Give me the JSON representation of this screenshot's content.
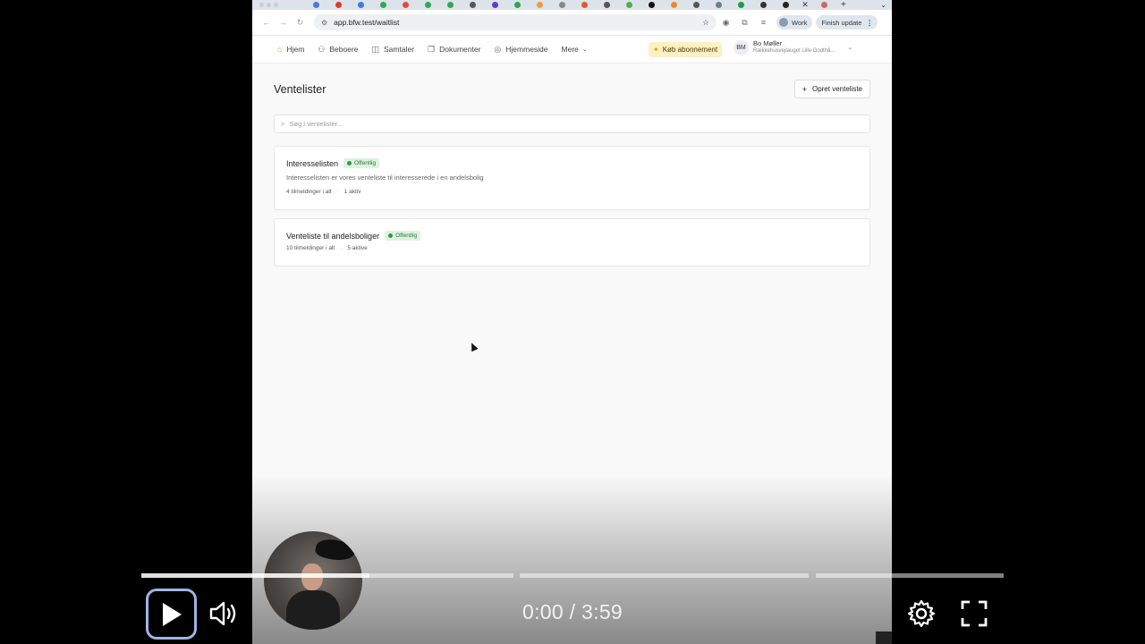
{
  "browser": {
    "url": "app.bfw.test/waitlist",
    "profile_label": "Work",
    "update_label": "Finish update",
    "new_tab": "+",
    "close_tab": "✕"
  },
  "app_nav": {
    "items": [
      {
        "label": "Hjem",
        "icon": "home-icon"
      },
      {
        "label": "Beboere",
        "icon": "users-icon"
      },
      {
        "label": "Samtaler",
        "icon": "chat-icon"
      },
      {
        "label": "Dokumenter",
        "icon": "documents-icon"
      },
      {
        "label": "Hjemmeside",
        "icon": "globe-icon"
      },
      {
        "label": "Mere",
        "icon": "chevron-down-icon"
      }
    ],
    "subscribe_label": "Køb abonnement",
    "user": {
      "initials": "BM",
      "name": "Bo Møller",
      "org": "Rækkehusvejlauget Lille Godthå..."
    }
  },
  "page": {
    "title": "Ventelister",
    "create_button": "Opret venteliste",
    "search_placeholder": "Søg i ventelister..."
  },
  "waitlists": [
    {
      "name": "Interesselisten",
      "badge": "Offentlig",
      "description": "Interesselisten er vores venteliste til interesserede i en andelsbolig",
      "total": "4 tilmeldinger i alt",
      "active": "1 aktiv"
    },
    {
      "name": "Venteliste til andelsboliger",
      "badge": "Offentlig",
      "total": "10 tilmeldinger i alt",
      "active": "5 aktive"
    }
  ],
  "player": {
    "time": "0:00 / 3:59"
  },
  "colors": {
    "accent_home": "#f08a24",
    "badge_bg": "#ddf3df",
    "badge_text": "#237a34",
    "subscribe_bg": "#fdf0c2"
  }
}
